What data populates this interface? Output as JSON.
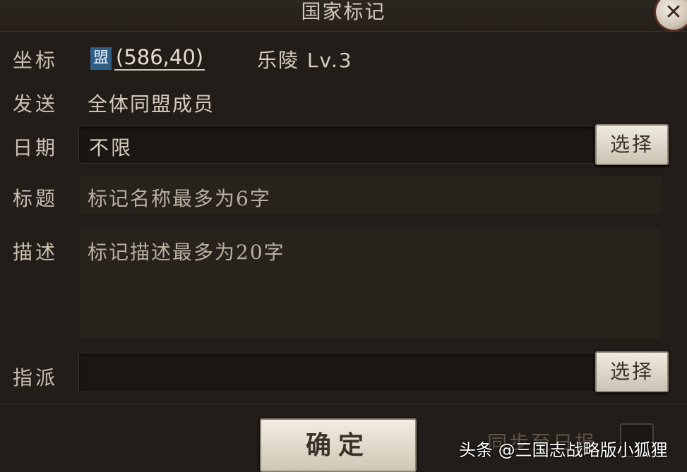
{
  "dialog": {
    "title": "国家标记"
  },
  "coordinate": {
    "label": "坐标",
    "alliance_icon_text": "盟",
    "value": "(586,40)",
    "place": "乐陵 Lv.3"
  },
  "send": {
    "label": "发送",
    "value": "全体同盟成员"
  },
  "date": {
    "label": "日期",
    "value": "不限",
    "button": "选择"
  },
  "title_field": {
    "label": "标题",
    "placeholder": "标记名称最多为6字"
  },
  "description": {
    "label": "描述",
    "placeholder": "标记描述最多为20字"
  },
  "assign": {
    "label": "指派",
    "value": "",
    "button": "选择"
  },
  "footer": {
    "confirm": "确定",
    "sync_label": "同步至日报",
    "watermark": "头条 @三国志战略版小狐狸"
  },
  "colors": {
    "background": "#221d19",
    "alliance_blue": "#2e5d86",
    "button_face": "#f0ebe0"
  },
  "icons": {
    "close": "close-icon",
    "alliance": "alliance-icon"
  }
}
